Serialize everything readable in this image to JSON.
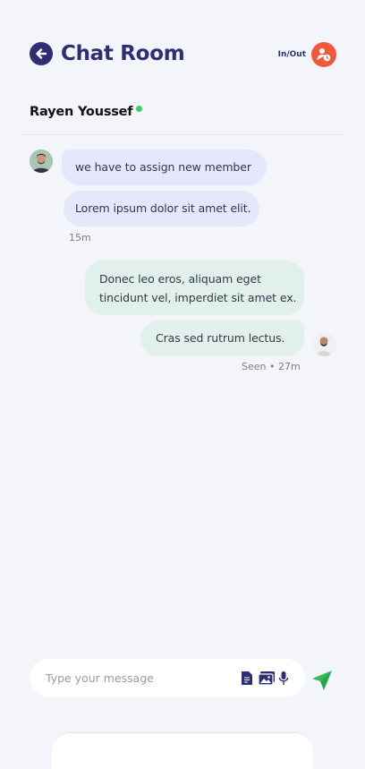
{
  "header": {
    "title": "Chat Room",
    "inout_label": "In/Out",
    "accent_color": "#2f2d73",
    "inout_color": "#ef5a3c"
  },
  "contact": {
    "name": "Rayen Youssef",
    "status": "online",
    "status_color": "#3ccf62"
  },
  "messages": [
    {
      "side": "incoming",
      "text": "we have to assign new member"
    },
    {
      "side": "incoming",
      "text": "Lorem ipsum dolor sit amet elit."
    },
    {
      "side": "outgoing",
      "lines": [
        "Donec leo eros, aliquam eget",
        "tincidunt vel, imperdiet sit amet ex."
      ]
    },
    {
      "side": "outgoing",
      "text": "Cras sed rutrum lectus."
    }
  ],
  "incoming_time": "15m",
  "outgoing_status": "Seen • 27m",
  "composer": {
    "placeholder": "Type your message",
    "icons": [
      "document-icon",
      "gallery-icon",
      "microphone-icon"
    ],
    "send_icon": "send-icon",
    "send_color": "#2fbf55"
  },
  "colors": {
    "background": "#f4f5fb",
    "incoming_bubble": "#e5e7fb",
    "outgoing_bubble": "#e1f0ea"
  }
}
